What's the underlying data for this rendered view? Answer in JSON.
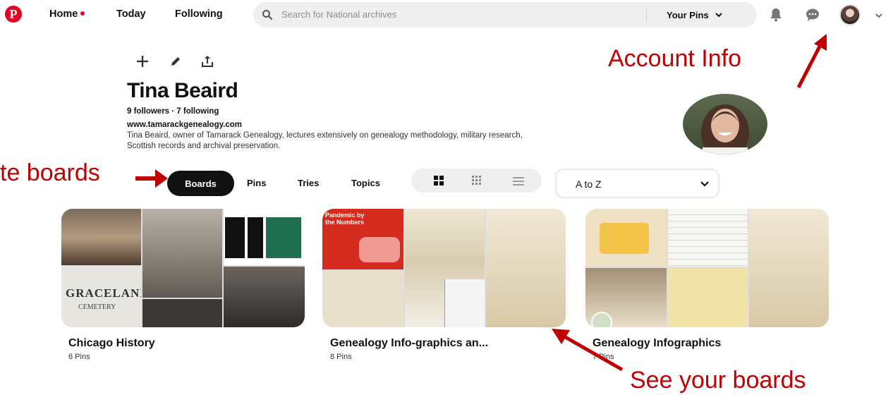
{
  "nav": {
    "home_label": "Home",
    "today_label": "Today",
    "following_label": "Following",
    "search_placeholder": "Search for National archives",
    "your_pins_label": "Your Pins"
  },
  "profile": {
    "name": "Tina Beaird",
    "follow_stats": "9 followers · 7 following",
    "website": "www.tamarackgenealogy.com",
    "bio": "Tina Beaird, owner of Tamarack Genealogy, lectures extensively on genealogy methodology, military research, Scottish records and archival preservation."
  },
  "tabs": [
    "Boards",
    "Pins",
    "Tries",
    "Topics"
  ],
  "sort": {
    "selected": "A to Z"
  },
  "boards": [
    {
      "title": "Chicago History",
      "count": "6 Pins",
      "cover_text": "GRACELAND",
      "cover_subtext": "CEMETERY"
    },
    {
      "title": "Genealogy Info-graphics an...",
      "count": "8 Pins",
      "cover_text": "Pandemic by the Numbers"
    },
    {
      "title": "Genealogy Infographics",
      "count": "7 Pins"
    }
  ],
  "annotations": {
    "account_info": "Account Info",
    "create_boards": "te boards",
    "see_boards": "See your boards"
  },
  "colors": {
    "brand": "#e60023",
    "annotation": "#c00000",
    "active_tab": "#111111"
  },
  "icons": [
    "pinterest-logo-icon",
    "search-icon",
    "chevron-down-icon",
    "bell-icon",
    "chat-icon",
    "plus-icon",
    "pencil-icon",
    "share-icon",
    "grid-large-icon",
    "grid-small-icon",
    "list-icon"
  ]
}
